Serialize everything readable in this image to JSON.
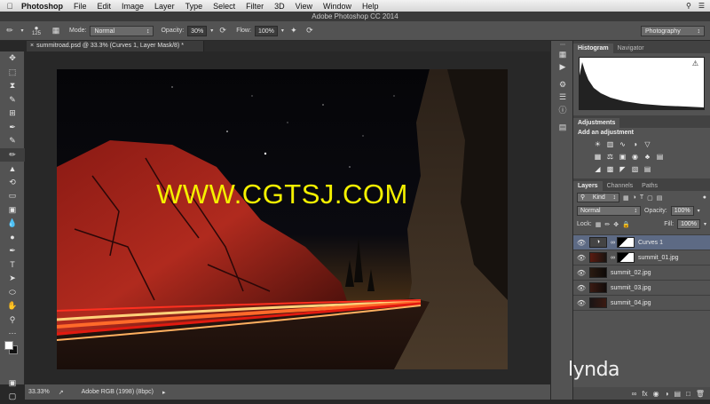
{
  "menubar": {
    "apple": "",
    "app_name": "Photoshop",
    "items": [
      "File",
      "Edit",
      "Image",
      "Layer",
      "Type",
      "Select",
      "Filter",
      "3D",
      "View",
      "Window",
      "Help"
    ]
  },
  "window_title": "Adobe Photoshop CC 2014",
  "options": {
    "brush_size": "125",
    "mode_label": "Mode:",
    "mode_value": "Normal",
    "opacity_label": "Opacity:",
    "opacity_value": "30%",
    "flow_label": "Flow:",
    "flow_value": "100%",
    "workspace": "Photography"
  },
  "document_tab": "summitroad.psd @ 33.3% (Curves 1, Layer Mask/8) *",
  "watermark": "WWW.CGTSJ.COM",
  "status": {
    "zoom": "33.33%",
    "profile": "Adobe RGB (1998) (8bpc)"
  },
  "histogram_panel": {
    "tabs": [
      "Histogram",
      "Navigator"
    ],
    "warning_icon": "warning-icon"
  },
  "adjustments": {
    "tab": "Adjustments",
    "title": "Add an adjustment"
  },
  "layers_panel": {
    "tabs": [
      "Layers",
      "Channels",
      "Paths"
    ],
    "kind_label": "Kind",
    "blend_mode": "Normal",
    "opacity_label": "Opacity:",
    "opacity_value": "100%",
    "lock_label": "Lock:",
    "fill_label": "Fill:",
    "fill_value": "100%",
    "layers": [
      {
        "name": "Curves 1",
        "active": true
      },
      {
        "name": "summit_01.jpg",
        "active": false
      },
      {
        "name": "summit_02.jpg",
        "active": false
      },
      {
        "name": "summit_03.jpg",
        "active": false
      },
      {
        "name": "summit_04.jpg",
        "active": false
      }
    ]
  },
  "branding": "lynda",
  "colors": {
    "watermark": "#f5f100",
    "active_layer": "#5d6a84",
    "panel_bg": "#535353"
  }
}
